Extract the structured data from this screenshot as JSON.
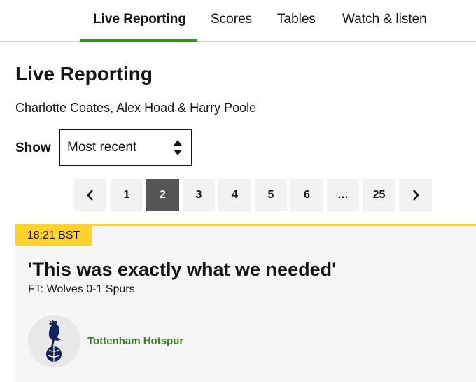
{
  "nav": {
    "tabs": [
      {
        "label": "Live Reporting",
        "active": true
      },
      {
        "label": "Scores",
        "active": false
      },
      {
        "label": "Tables",
        "active": false
      },
      {
        "label": "Watch & listen",
        "active": false
      }
    ],
    "accent": "#3f8d21"
  },
  "page": {
    "title": "Live Reporting",
    "authors": "Charlotte Coates, Alex Hoad & Harry Poole"
  },
  "sort": {
    "label": "Show",
    "selected": "Most recent"
  },
  "pagination": {
    "prev_icon": "chevron-left-icon",
    "next_icon": "chevron-right-icon",
    "pages": [
      "1",
      "2",
      "3",
      "4",
      "5",
      "6",
      "…",
      "25"
    ],
    "current": "2"
  },
  "post": {
    "time": "18:21 BST",
    "title": "'This was exactly what we needed'",
    "subtitle": "FT: Wolves 0-1 Spurs",
    "author": "Tottenham Hotspur",
    "avatar_icon": "tottenham-crest-icon",
    "badge_color": "#ffd230",
    "author_color": "#3f7b25"
  }
}
